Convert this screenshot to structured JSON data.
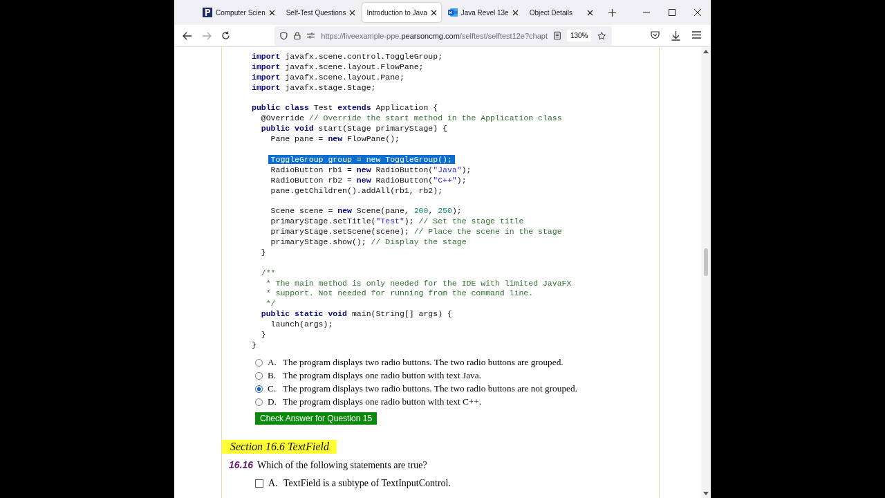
{
  "browser": {
    "tabs": [
      {
        "title": "Computer Scien",
        "kind": "logo",
        "selected": false
      },
      {
        "title": "Self-Test Questions",
        "kind": "plain",
        "selected": false
      },
      {
        "title": "Introduction to Java",
        "kind": "plain",
        "selected": true
      },
      {
        "title": "Java Revel 13e",
        "kind": "document",
        "selected": false
      },
      {
        "title": "Object Details",
        "kind": "plain",
        "selected": false
      }
    ],
    "url": {
      "prefix": "https://liveexample-ppe.",
      "domain": "pearsoncmg.com",
      "rest": "/selftest/selftest12e?chapt"
    },
    "zoom": "130%"
  },
  "code": [
    {
      "kind": "code",
      "highlighted": false,
      "segments": [
        {
          "t": "import",
          "kind": "keyword"
        },
        {
          "t": " javafx.scene.control.ToggleGroup;",
          "kind": "plain"
        }
      ]
    },
    {
      "kind": "code",
      "highlighted": false,
      "segments": [
        {
          "t": "import",
          "kind": "keyword"
        },
        {
          "t": " javafx.scene.layout.FlowPane;",
          "kind": "plain"
        }
      ]
    },
    {
      "kind": "code",
      "highlighted": false,
      "segments": [
        {
          "t": "import",
          "kind": "keyword"
        },
        {
          "t": " javafx.scene.layout.Pane;",
          "kind": "plain"
        }
      ]
    },
    {
      "kind": "code",
      "highlighted": false,
      "segments": [
        {
          "t": "import",
          "kind": "keyword"
        },
        {
          "t": " javafx.stage.Stage;",
          "kind": "plain"
        }
      ]
    },
    {
      "kind": "blank"
    },
    {
      "kind": "code",
      "highlighted": false,
      "segments": [
        {
          "t": "public class",
          "kind": "keyword"
        },
        {
          "t": " Test ",
          "kind": "plain"
        },
        {
          "t": "extends",
          "kind": "keyword"
        },
        {
          "t": " Application {",
          "kind": "plain"
        }
      ]
    },
    {
      "kind": "code",
      "highlighted": false,
      "segments": [
        {
          "t": "  @Override ",
          "kind": "plain"
        },
        {
          "t": "// Override the start method in the Application class",
          "kind": "comment"
        }
      ]
    },
    {
      "kind": "code",
      "highlighted": false,
      "segments": [
        {
          "t": "  public void",
          "kind": "keyword"
        },
        {
          "t": " start(Stage primaryStage) {",
          "kind": "plain"
        }
      ]
    },
    {
      "kind": "code",
      "highlighted": false,
      "segments": [
        {
          "t": "    Pane pane = ",
          "kind": "plain"
        },
        {
          "t": "new",
          "kind": "keyword"
        },
        {
          "t": " FlowPane();",
          "kind": "plain"
        }
      ]
    },
    {
      "kind": "blank"
    },
    {
      "kind": "code",
      "highlighted": true,
      "segments": [
        {
          "t": "    ToggleGroup group = new ToggleGroup();",
          "kind": "plain"
        }
      ]
    },
    {
      "kind": "code",
      "highlighted": false,
      "segments": [
        {
          "t": "    RadioButton rb1 = ",
          "kind": "plain"
        },
        {
          "t": "new",
          "kind": "keyword"
        },
        {
          "t": " RadioButton(",
          "kind": "plain"
        },
        {
          "t": "\"Java\"",
          "kind": "string"
        },
        {
          "t": ");",
          "kind": "plain"
        }
      ]
    },
    {
      "kind": "code",
      "highlighted": false,
      "segments": [
        {
          "t": "    RadioButton rb2 = ",
          "kind": "plain"
        },
        {
          "t": "new",
          "kind": "keyword"
        },
        {
          "t": " RadioButton(",
          "kind": "plain"
        },
        {
          "t": "\"C++\"",
          "kind": "string"
        },
        {
          "t": ");",
          "kind": "plain"
        }
      ]
    },
    {
      "kind": "code",
      "highlighted": false,
      "segments": [
        {
          "t": "    pane.getChildren().addAll(rb1, rb2);",
          "kind": "plain"
        }
      ]
    },
    {
      "kind": "blank"
    },
    {
      "kind": "code",
      "highlighted": false,
      "segments": [
        {
          "t": "    Scene scene = ",
          "kind": "plain"
        },
        {
          "t": "new",
          "kind": "keyword"
        },
        {
          "t": " Scene(pane, ",
          "kind": "plain"
        },
        {
          "t": "200",
          "kind": "number"
        },
        {
          "t": ", ",
          "kind": "plain"
        },
        {
          "t": "250",
          "kind": "number"
        },
        {
          "t": ");",
          "kind": "plain"
        }
      ]
    },
    {
      "kind": "code",
      "highlighted": false,
      "segments": [
        {
          "t": "    primaryStage.setTitle(",
          "kind": "plain"
        },
        {
          "t": "\"Test\"",
          "kind": "string"
        },
        {
          "t": "); ",
          "kind": "plain"
        },
        {
          "t": "// Set the stage title",
          "kind": "comment"
        }
      ]
    },
    {
      "kind": "code",
      "highlighted": false,
      "segments": [
        {
          "t": "    primaryStage.setScene(scene); ",
          "kind": "plain"
        },
        {
          "t": "// Place the scene in the stage",
          "kind": "comment"
        }
      ]
    },
    {
      "kind": "code",
      "highlighted": false,
      "segments": [
        {
          "t": "    primaryStage.show(); ",
          "kind": "plain"
        },
        {
          "t": "// Display the stage",
          "kind": "comment"
        }
      ]
    },
    {
      "kind": "code",
      "highlighted": false,
      "segments": [
        {
          "t": "  }",
          "kind": "plain"
        }
      ]
    },
    {
      "kind": "blank"
    },
    {
      "kind": "code",
      "highlighted": false,
      "segments": [
        {
          "t": "  /**",
          "kind": "comment"
        }
      ]
    },
    {
      "kind": "code",
      "highlighted": false,
      "segments": [
        {
          "t": "   * The main method is only needed for the IDE with limited JavaFX",
          "kind": "comment"
        }
      ]
    },
    {
      "kind": "code",
      "highlighted": false,
      "segments": [
        {
          "t": "   * support. Not needed for running from the command line.",
          "kind": "comment"
        }
      ]
    },
    {
      "kind": "code",
      "highlighted": false,
      "segments": [
        {
          "t": "   */",
          "kind": "comment"
        }
      ]
    },
    {
      "kind": "code",
      "highlighted": false,
      "segments": [
        {
          "t": "  public static void",
          "kind": "keyword"
        },
        {
          "t": " main(String[] args) {",
          "kind": "plain"
        }
      ]
    },
    {
      "kind": "code",
      "highlighted": false,
      "segments": [
        {
          "t": "    launch(args);",
          "kind": "plain"
        }
      ]
    },
    {
      "kind": "code",
      "highlighted": false,
      "segments": [
        {
          "t": "  }",
          "kind": "plain"
        }
      ]
    },
    {
      "kind": "code",
      "highlighted": false,
      "segments": [
        {
          "t": "}",
          "kind": "plain"
        }
      ]
    }
  ],
  "options": [
    {
      "letter": "A.",
      "text": "The program displays two radio buttons. The two radio buttons are grouped.",
      "selected": false
    },
    {
      "letter": "B.",
      "text": "The program displays one radio button with text Java.",
      "selected": false
    },
    {
      "letter": "C.",
      "text": "The program displays two radio buttons. The two radio buttons are not grouped.",
      "selected": true
    },
    {
      "letter": "D.",
      "text": "The program displays one radio button with text C++.",
      "selected": false
    }
  ],
  "check_button": "Check Answer for Question 15",
  "section_heading": "Section 16.6 TextField",
  "next_question": {
    "number": "16.16",
    "text": "Which of the following statements are true?",
    "options": [
      {
        "letter": "A.",
        "text": "TextField is a subtype of TextInputControl.",
        "checked": false
      }
    ]
  }
}
